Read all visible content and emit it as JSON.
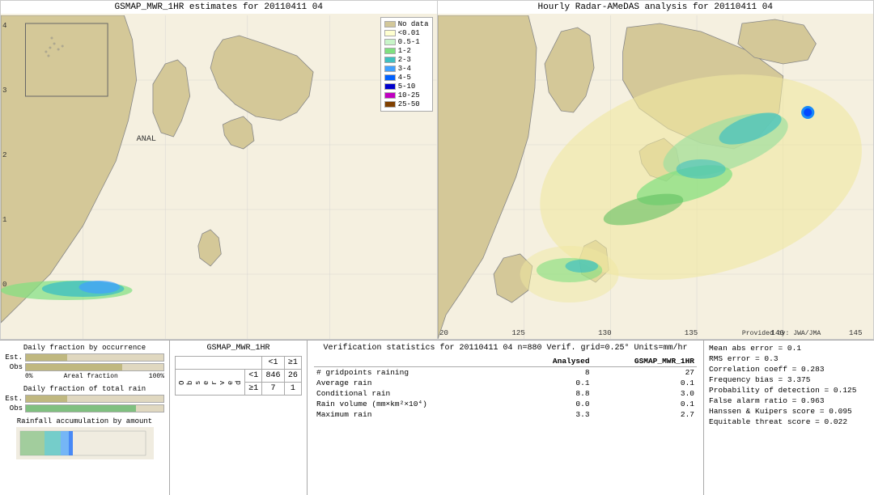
{
  "left_map": {
    "title": "GSMAP_MWR_1HR estimates for 20110411 04",
    "anal_label": "ANAL",
    "legend": {
      "items": [
        {
          "label": "No data",
          "color": "#d3c89a"
        },
        {
          "label": "<0.01",
          "color": "#ffffd0"
        },
        {
          "label": "0.5-1",
          "color": "#c8f5c8"
        },
        {
          "label": "1-2",
          "color": "#80e080"
        },
        {
          "label": "2-3",
          "color": "#40c0c0"
        },
        {
          "label": "3-4",
          "color": "#40a0ff"
        },
        {
          "label": "4-5",
          "color": "#0060ff"
        },
        {
          "label": "5-10",
          "color": "#0000cc"
        },
        {
          "label": "10-25",
          "color": "#c000c0"
        },
        {
          "label": "25-50",
          "color": "#804000"
        }
      ]
    }
  },
  "right_map": {
    "title": "Hourly Radar-AMeDAS analysis for 20110411 04",
    "credit": "Provided by: JWA/JMA"
  },
  "bar_charts": {
    "title1": "Daily fraction by occurrence",
    "title2": "Daily fraction of total rain",
    "title3": "Rainfall accumulation by amount",
    "est_label": "Est.",
    "obs_label": "Obs",
    "x_label_0": "0%",
    "x_label_100": "Areal fraction",
    "x_label_end": "100%",
    "bar1_est_pct": 0.3,
    "bar1_obs_pct": 0.7,
    "bar2_est_pct": 0.3,
    "bar2_obs_pct": 0.8
  },
  "contingency": {
    "title": "GSMAP_MWR_1HR",
    "col_lt1": "<1",
    "col_ge1": "≥1",
    "row_lt1": "<1",
    "row_ge1": "≥1",
    "observed_label": "O\nb\ns\ne\nr\nv\ne\nd",
    "cell_lt1_lt1": "846",
    "cell_lt1_ge1": "26",
    "cell_ge1_lt1": "7",
    "cell_ge1_ge1": "1"
  },
  "verif_stats": {
    "title": "Verification statistics for 20110411 04  n=880  Verif. grid=0.25°  Units=mm/hr",
    "col_header_analysed": "Analysed",
    "col_header_gsmap": "GSMAP_MWR_1HR",
    "rows": [
      {
        "label": "# gridpoints raining",
        "analysed": "8",
        "gsmap": "27"
      },
      {
        "label": "Average rain",
        "analysed": "0.1",
        "gsmap": "0.1"
      },
      {
        "label": "Conditional rain",
        "analysed": "8.8",
        "gsmap": "3.0"
      },
      {
        "label": "Rain volume (mm×km²×10⁴)",
        "analysed": "0.0",
        "gsmap": "0.1"
      },
      {
        "label": "Maximum rain",
        "analysed": "3.3",
        "gsmap": "2.7"
      }
    ]
  },
  "right_stats": {
    "lines": [
      "Mean abs error = 0.1",
      "RMS error = 0.3",
      "Correlation coeff = 0.283",
      "Frequency bias = 3.375",
      "Probability of detection = 0.125",
      "False alarm ratio = 0.963",
      "Hanssen & Kuipers score = 0.095",
      "Equitable threat score = 0.022"
    ]
  }
}
